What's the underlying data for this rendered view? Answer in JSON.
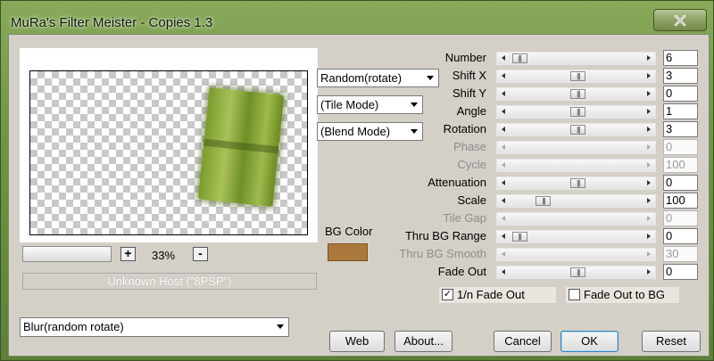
{
  "window": {
    "title": "MuRa's Filter Meister - Copies 1.3",
    "close_icon": "close-icon"
  },
  "preview": {
    "zoom_plus": "+",
    "zoom_level": "33%",
    "zoom_minus": "-",
    "host_text": "Unknown Host (\"8PSP\")"
  },
  "dropdowns": {
    "mode": "Random(rotate)",
    "tile": "(Tile Mode)",
    "blend": "(Blend Mode)",
    "bottom": "Blur(random rotate)"
  },
  "bg_color": {
    "label": "BG Color",
    "color": "#a9783a"
  },
  "params": [
    {
      "label": "Number",
      "value": "6",
      "enabled": true,
      "slider_fraction": 0.14
    },
    {
      "label": "Shift X",
      "value": "3",
      "enabled": true,
      "slider_fraction": 0.51
    },
    {
      "label": "Shift Y",
      "value": "0",
      "enabled": true,
      "slider_fraction": 0.51
    },
    {
      "label": "Angle",
      "value": "1",
      "enabled": true,
      "slider_fraction": 0.51
    },
    {
      "label": "Rotation",
      "value": "3",
      "enabled": true,
      "slider_fraction": 0.51
    },
    {
      "label": "Phase",
      "value": "0",
      "enabled": false
    },
    {
      "label": "Cycle",
      "value": "100",
      "enabled": false
    },
    {
      "label": "Attenuation",
      "value": "0",
      "enabled": true,
      "slider_fraction": 0.51
    },
    {
      "label": "Scale",
      "value": "100",
      "enabled": true,
      "slider_fraction": 0.29
    },
    {
      "label": "Tile Gap",
      "value": "0",
      "enabled": false
    },
    {
      "label": "Thru BG Range",
      "value": "0",
      "enabled": true,
      "slider_fraction": 0.14
    },
    {
      "label": "Thru BG Smooth",
      "value": "30",
      "enabled": false
    },
    {
      "label": "Fade Out",
      "value": "0",
      "enabled": true,
      "slider_fraction": 0.51
    }
  ],
  "checkboxes": [
    {
      "label": "1/n Fade Out",
      "checked": true,
      "mark": "✓"
    },
    {
      "label": "Fade Out to BG",
      "checked": false,
      "mark": ""
    }
  ],
  "buttons": {
    "web": "Web",
    "about": "About...",
    "cancel": "Cancel",
    "ok": "OK",
    "reset": "Reset"
  }
}
